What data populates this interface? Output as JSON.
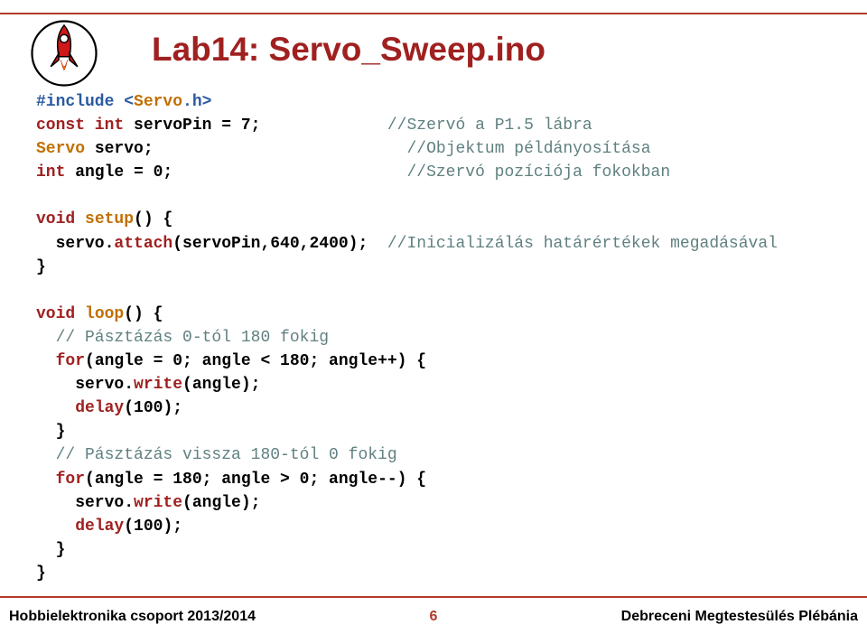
{
  "title": "Lab14: Servo_Sweep.ino",
  "code": {
    "l1a": "#include <",
    "l1b": "Servo",
    "l1c": ".h>",
    "l2a": "const int",
    "l2b": " servoPin = 7;             ",
    "l2c": "//Szervó a P1.5 lábra",
    "l3a": "Servo",
    "l3b": " servo;                          ",
    "l3c": "//Objektum példányosítása",
    "l4a": "int",
    "l4b": " angle = 0;                        ",
    "l4c": "//Szervó pozíciója fokokban",
    "l5a": "void",
    "l5b": " ",
    "l5c": "setup",
    "l5d": "() {",
    "l6a": "  servo.",
    "l6b": "attach",
    "l6c": "(servoPin,640,2400);  ",
    "l6d": "//Inicializálás határértékek megadásával",
    "l7": "}",
    "l8a": "void",
    "l8b": " ",
    "l8c": "loop",
    "l8d": "() {",
    "l9": "  // Pásztázás 0-tól 180 fokig",
    "l10a": "  for",
    "l10b": "(angle = 0; angle < 180; angle++) {",
    "l11a": "    servo.",
    "l11b": "write",
    "l11c": "(angle);",
    "l12a": "    ",
    "l12b": "delay",
    "l12c": "(100);",
    "l13": "  }",
    "l14": "  // Pásztázás vissza 180-tól 0 fokig",
    "l15a": "  for",
    "l15b": "(angle = 180; angle > 0; angle--) {",
    "l16a": "    servo.",
    "l16b": "write",
    "l16c": "(angle);",
    "l17a": "    ",
    "l17b": "delay",
    "l17c": "(100);",
    "l18": "  }",
    "l19": "}"
  },
  "footer": {
    "left": "Hobbielektronika csoport 2013/2014",
    "center": "6",
    "right": "Debreceni Megtestesülés Plébánia"
  }
}
